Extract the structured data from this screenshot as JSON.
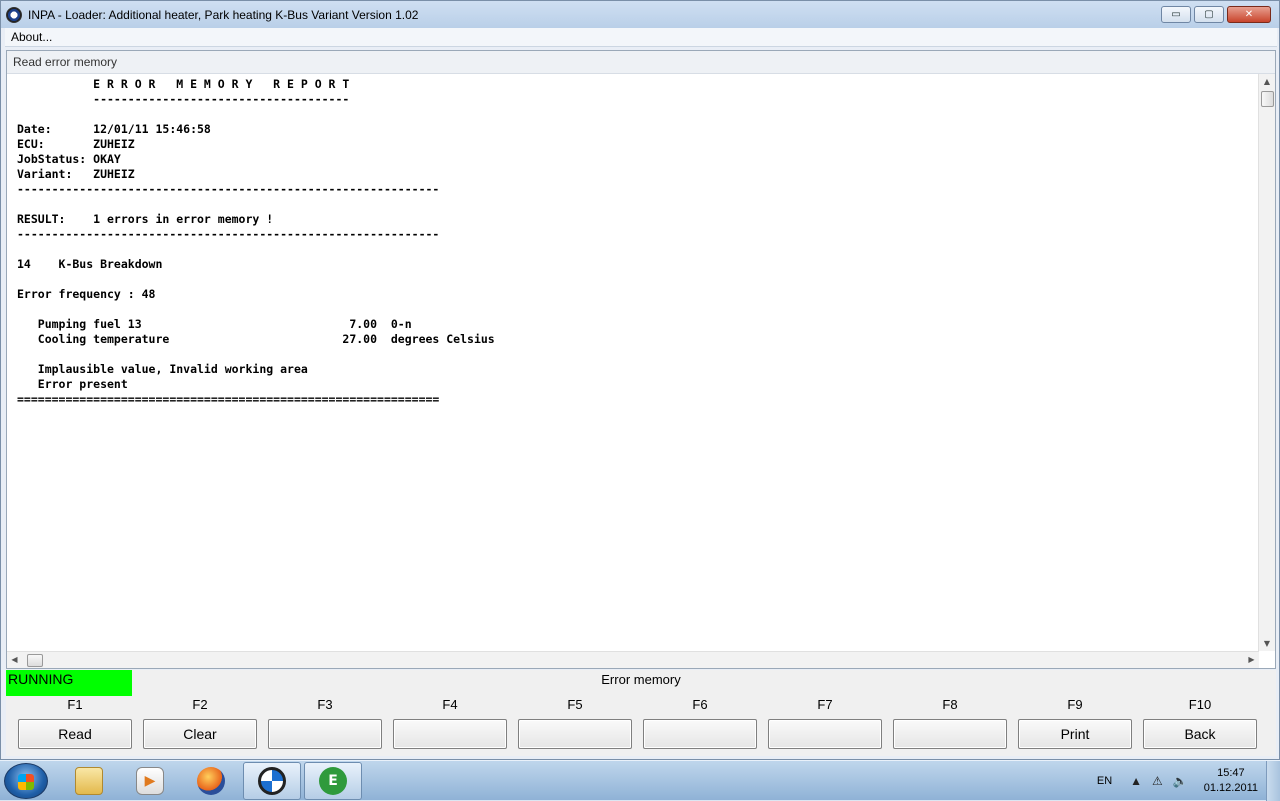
{
  "window": {
    "title": "INPA - Loader:  Additional heater, Park heating K-Bus Variant Version 1.02",
    "controls": {
      "minimize": "▭",
      "maximize": "▢",
      "close": "✕"
    }
  },
  "menu": {
    "items": [
      "About..."
    ]
  },
  "panel": {
    "header": "Read error memory",
    "report_lines": [
      "           E R R O R   M E M O R Y   R E P O R T",
      "           -------------------------------------",
      "",
      "Date:      12/01/11 15:46:58",
      "ECU:       ZUHEIZ",
      "JobStatus: OKAY",
      "Variant:   ZUHEIZ",
      "-------------------------------------------------------------",
      "",
      "RESULT:    1 errors in error memory !",
      "-------------------------------------------------------------",
      "",
      "14    K-Bus Breakdown",
      "",
      "Error frequency : 48",
      "",
      "   Pumping fuel 13                              7.00  0-n",
      "   Cooling temperature                         27.00  degrees Celsius",
      "",
      "   Implausible value, Invalid working area",
      "   Error present",
      "============================================================="
    ]
  },
  "status": {
    "state": "RUNNING",
    "state_color": "#00ff00",
    "title": "Error memory"
  },
  "fkeys": [
    {
      "key": "F1",
      "label": "Read"
    },
    {
      "key": "F2",
      "label": "Clear"
    },
    {
      "key": "F3",
      "label": ""
    },
    {
      "key": "F4",
      "label": ""
    },
    {
      "key": "F5",
      "label": ""
    },
    {
      "key": "F6",
      "label": ""
    },
    {
      "key": "F7",
      "label": ""
    },
    {
      "key": "F8",
      "label": ""
    },
    {
      "key": "F9",
      "label": "Print"
    },
    {
      "key": "F10",
      "label": "Back"
    }
  ],
  "taskbar": {
    "apps": [
      {
        "name": "explorer",
        "icon": "folder-icon",
        "glyph": "",
        "active": false
      },
      {
        "name": "media-player",
        "icon": "media-player-icon",
        "glyph": "▶",
        "active": false
      },
      {
        "name": "firefox",
        "icon": "firefox-icon",
        "glyph": "",
        "active": false
      },
      {
        "name": "inpa",
        "icon": "bmw-icon",
        "glyph": "",
        "active": true
      },
      {
        "name": "ediabas",
        "icon": "ediabas-icon",
        "glyph": "E",
        "active": true
      }
    ],
    "tray": {
      "language": "EN",
      "time": "15:47",
      "date": "01.12.2011"
    }
  }
}
